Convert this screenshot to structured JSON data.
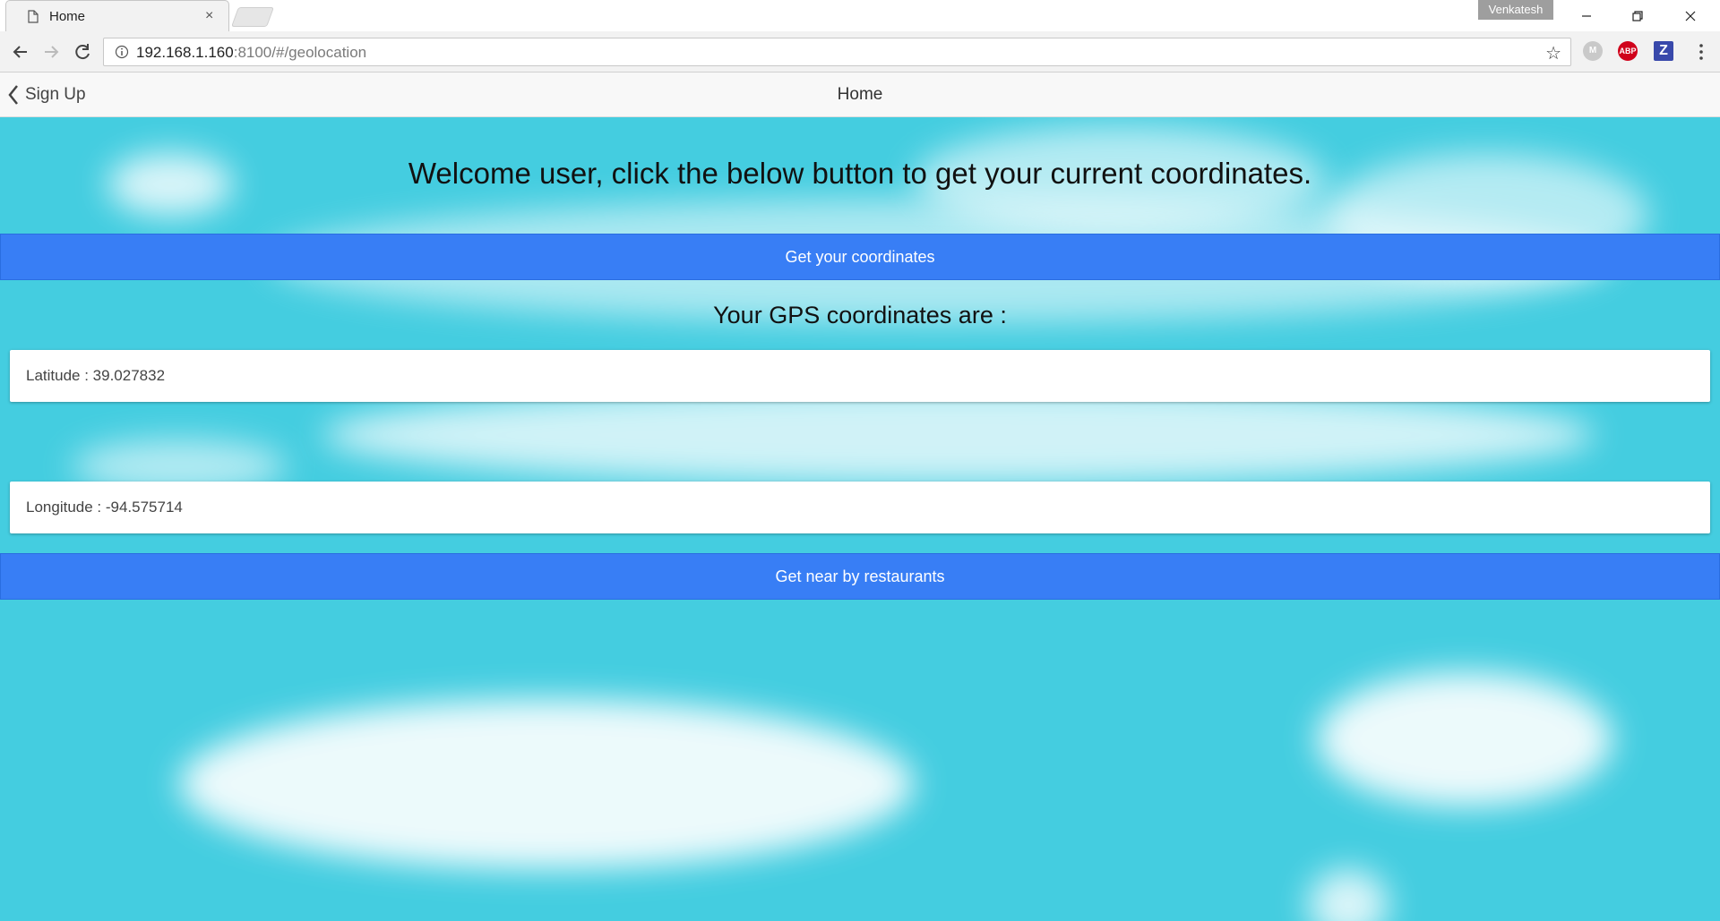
{
  "browser": {
    "tab_title": "Home",
    "tab_close": "×",
    "profile_name": "Venkatesh",
    "url_host": "192.168.1.160",
    "url_path": ":8100/#/geolocation",
    "extensions": [
      {
        "name": "extension-gray-icon",
        "label": "M",
        "color": "#c9c9c9"
      },
      {
        "name": "adblock-plus-icon",
        "label": "ABP",
        "color": "#d0021b"
      },
      {
        "name": "zotero-icon",
        "label": "Z",
        "color": "#3949ab"
      }
    ]
  },
  "header": {
    "back_label": "Sign Up",
    "title": "Home"
  },
  "main": {
    "welcome": "Welcome user, click the below button to get your current coordinates.",
    "get_coords_button": "Get your coordinates",
    "gps_heading": "Your GPS coordinates are :",
    "latitude": "Latitude : 39.027832",
    "longitude": "Longitude : -94.575714",
    "restaurants_button": "Get near by restaurants"
  },
  "colors": {
    "sky": "#44cde0",
    "button": "#387ef5"
  }
}
